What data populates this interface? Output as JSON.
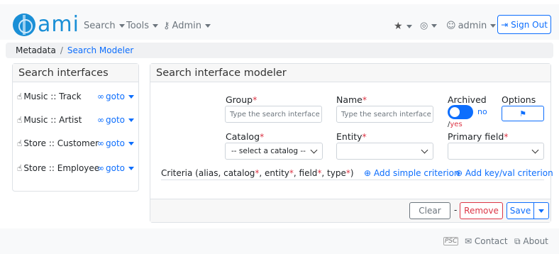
{
  "navbar": {
    "logo_text": "ami",
    "menu": [
      {
        "label": "Search"
      },
      {
        "label": "Tools"
      },
      {
        "label": "Admin"
      }
    ],
    "user_label": "admin",
    "signout_label": "Sign Out"
  },
  "breadcrumb": {
    "root": "Metadata",
    "separator": "/",
    "current": "Search Modeler"
  },
  "search_interfaces": {
    "title": "Search interfaces",
    "goto_label": "goto",
    "items": [
      {
        "label": "Music :: Track"
      },
      {
        "label": "Music :: Artist"
      },
      {
        "label": "Store :: Customer"
      },
      {
        "label": "Store :: Employee"
      }
    ]
  },
  "modeler": {
    "title": "Search interface modeler",
    "group": {
      "label": "Group",
      "placeholder": "Type the search interface g"
    },
    "name": {
      "label": "Name",
      "placeholder": "Type the search interface r"
    },
    "archived": {
      "label": "Archived",
      "toggle_text": "no",
      "alt_slash": "/",
      "alt_text": "yes"
    },
    "options": {
      "label": "Options"
    },
    "catalog": {
      "label": "Catalog",
      "value": "-- select a catalog --"
    },
    "entity": {
      "label": "Entity",
      "value": ""
    },
    "primary_field": {
      "label": "Primary field",
      "value": ""
    },
    "criteria": {
      "p1": "Criteria (alias, catalog",
      "p2": ", entity",
      "p3": ", field",
      "p4": ", type",
      "p5": ")",
      "star": "*",
      "add_simple": "Add simple criterion",
      "add_keyval": "Add key/val criterion"
    },
    "buttons": {
      "clear": "Clear",
      "dash": "-",
      "remove": "Remove",
      "save": "Save"
    }
  },
  "footer": {
    "psc": "PSC",
    "contact": "Contact",
    "about": "About"
  },
  "colors": {
    "primary": "#0d6efd",
    "danger": "#dc3545",
    "logo": "#1a8fd6"
  }
}
